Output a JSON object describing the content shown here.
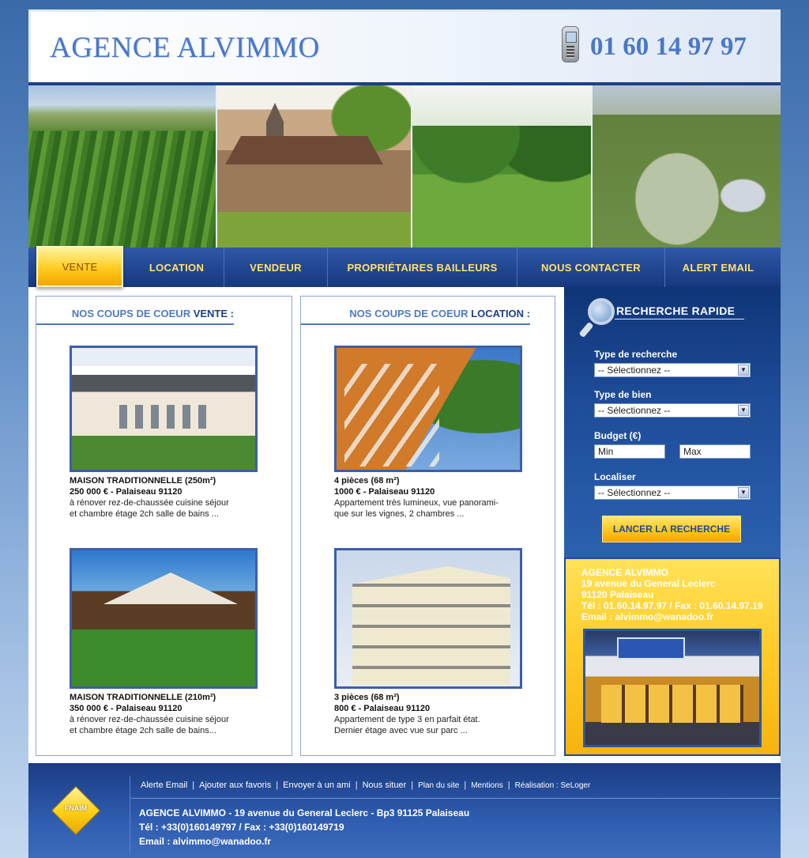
{
  "header": {
    "logo": "AGENCE ALVIMMO",
    "phone": "01 60 14 97 97"
  },
  "nav": {
    "items": [
      {
        "label": "VENTE"
      },
      {
        "label": "LOCATION"
      },
      {
        "label": "VENDEUR"
      },
      {
        "label": "PROPRIÉTAIRES BAILLEURS"
      },
      {
        "label": "NOUS CONTACTER"
      },
      {
        "label": "ALERT EMAIL"
      }
    ]
  },
  "vente": {
    "title_prefix": "NOS COUPS DE COEUR ",
    "title_strong": "VENTE :",
    "listings": [
      {
        "title": "MAISON TRADITIONNELLE (250m²)",
        "price": "250 000 € - Palaiseau 91120",
        "desc1": "à rénover rez-de-chaussée cuisine séjour",
        "desc2": "et chambre étage 2ch salle de bains ..."
      },
      {
        "title": "MAISON TRADITIONNELLE (210m²)",
        "price": "350 000 € - Palaiseau 91120",
        "desc1": "à rénover rez-de-chaussée cuisine séjour",
        "desc2": "et chambre étage 2ch salle de bains..."
      }
    ]
  },
  "location": {
    "title_prefix": "NOS COUPS DE COEUR ",
    "title_strong": "LOCATION :",
    "listings": [
      {
        "title": "4 pièces (68 m²)",
        "price": "1000 € - Palaiseau 91120",
        "desc1": "Appartement très lumineux, vue panorami-",
        "desc2": "que sur les vignes, 2 chambres ..."
      },
      {
        "title": "3 pièces (68 m²)",
        "price": "800 € - Palaiseau 91120",
        "desc1": "Appartement de type 3 en parfait état.",
        "desc2": "Dernier étage avec vue sur parc ..."
      }
    ]
  },
  "search": {
    "title": "RECHERCHE RAPIDE",
    "type_recherche_label": "Type de recherche",
    "type_recherche_value": "-- Sélectionnez --",
    "type_bien_label": "Type de bien",
    "type_bien_value": "-- Sélectionnez --",
    "budget_label": "Budget (€)",
    "min_value": "Min",
    "max_value": "Max",
    "localiser_label": "Localiser",
    "localiser_value": "-- Sélectionnez --",
    "button": "LANCER LA RECHERCHE"
  },
  "agency": {
    "name": "AGENCE ALVIMMO",
    "street": "19 avenue du General Leclerc",
    "city": "91120 Palaiseau",
    "phone": "Tél : 01.60.14.97.97 / Fax : 01.60.14.97.19",
    "email": "Email : alvimmo@wanadoo.fr",
    "sign_brand": "AGENCE ALVIMMO",
    "sign_services": "TOUTES TRANSACTIONS IMMOBILIERES",
    "sign_side": "GESTION LOCATION"
  },
  "footer": {
    "fnaim": "FNAIM",
    "links": [
      "Alerte Email",
      "Ajouter aux favoris",
      "Envoyer à un ami",
      "Nous situer",
      "Plan du site",
      "Mentions",
      "Réalisation : SeLoger"
    ],
    "address": "AGENCE ALVIMMO - 19 avenue du General Leclerc - Bp3 91125 Palaiseau",
    "phone": "Tél : +33(0)160149797 / Fax : +33(0)160149719",
    "email": "Email : alvimmo@wanadoo.fr"
  }
}
